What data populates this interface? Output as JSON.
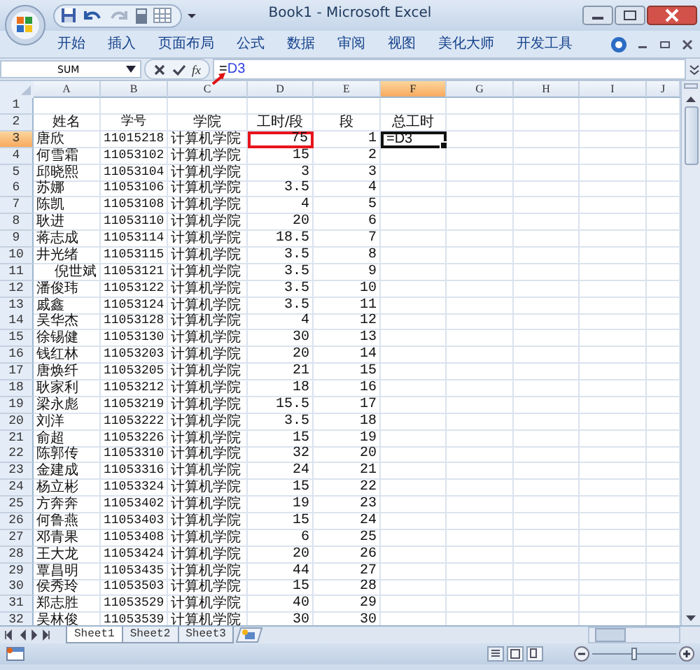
{
  "window": {
    "title": "Book1 - Microsoft Excel"
  },
  "ribbon_tabs": [
    {
      "label": "开始",
      "selected": false
    },
    {
      "label": "插入",
      "selected": false
    },
    {
      "label": "页面布局",
      "selected": false
    },
    {
      "label": "公式",
      "selected": false
    },
    {
      "label": "数据",
      "selected": false
    },
    {
      "label": "审阅",
      "selected": false
    },
    {
      "label": "视图",
      "selected": false
    },
    {
      "label": "美化大师",
      "selected": false
    },
    {
      "label": "开发工具",
      "selected": false
    }
  ],
  "formula_bar": {
    "name_box": "SUM",
    "function_button": "fx",
    "formula": [
      {
        "text": "=",
        "kind": "plain"
      },
      {
        "text": "D3",
        "kind": "reference"
      }
    ],
    "pointer_arrow": true
  },
  "sheet": {
    "columns": [
      {
        "label": "A",
        "selected": false
      },
      {
        "label": "B",
        "selected": false
      },
      {
        "label": "C",
        "selected": false
      },
      {
        "label": "D",
        "selected": false
      },
      {
        "label": "E",
        "selected": false
      },
      {
        "label": "F",
        "selected": true
      },
      {
        "label": "G",
        "selected": false
      },
      {
        "label": "H",
        "selected": false
      },
      {
        "label": "I",
        "selected": false
      },
      {
        "label": "J",
        "selected": false
      }
    ],
    "rows": [
      {
        "number": "1",
        "selected": false,
        "kind": "blank"
      },
      {
        "number": "2",
        "selected": false,
        "kind": "header",
        "cells": [
          "姓名",
          "学号",
          "学院",
          "工时/段",
          "段",
          "总工时"
        ]
      },
      {
        "number": "3",
        "selected": true,
        "kind": "data",
        "cells": [
          "唐欣",
          "11015218",
          "计算机学院",
          {
            "text": "75",
            "copied": true
          },
          "1",
          {
            "text": "=D3",
            "active": true
          }
        ]
      },
      {
        "number": "4",
        "selected": false,
        "kind": "data",
        "cells": [
          "何雪霜",
          "11053102",
          "计算机学院",
          "15",
          "2"
        ]
      },
      {
        "number": "5",
        "selected": false,
        "kind": "data",
        "cells": [
          "邱晓熙",
          "11053104",
          "计算机学院",
          "3",
          "3"
        ]
      },
      {
        "number": "6",
        "selected": false,
        "kind": "data",
        "cells": [
          "苏娜",
          "11053106",
          "计算机学院",
          "3.5",
          "4"
        ]
      },
      {
        "number": "7",
        "selected": false,
        "kind": "data",
        "cells": [
          "陈凯",
          "11053108",
          "计算机学院",
          "4",
          "5"
        ]
      },
      {
        "number": "8",
        "selected": false,
        "kind": "data",
        "cells": [
          "耿进",
          "11053110",
          "计算机学院",
          "20",
          "6"
        ]
      },
      {
        "number": "9",
        "selected": false,
        "kind": "data",
        "cells": [
          "蒋志成",
          "11053114",
          "计算机学院",
          "18.5",
          "7"
        ]
      },
      {
        "number": "10",
        "selected": false,
        "kind": "data",
        "cells": [
          "井光绪",
          "11053115",
          "计算机学院",
          "3.5",
          "8"
        ]
      },
      {
        "number": "11",
        "selected": false,
        "kind": "data_name_right",
        "cells": [
          "倪世斌",
          "11053121",
          "计算机学院",
          "3.5",
          "9"
        ]
      },
      {
        "number": "12",
        "selected": false,
        "kind": "data",
        "cells": [
          "潘俊玮",
          "11053122",
          "计算机学院",
          "3.5",
          "10"
        ]
      },
      {
        "number": "13",
        "selected": false,
        "kind": "data",
        "cells": [
          "戚鑫",
          "11053124",
          "计算机学院",
          "3.5",
          "11"
        ]
      },
      {
        "number": "14",
        "selected": false,
        "kind": "data",
        "cells": [
          "吴华杰",
          "11053128",
          "计算机学院",
          "4",
          "12"
        ]
      },
      {
        "number": "15",
        "selected": false,
        "kind": "data",
        "cells": [
          "徐锡健",
          "11053130",
          "计算机学院",
          "30",
          "13"
        ]
      },
      {
        "number": "16",
        "selected": false,
        "kind": "data",
        "cells": [
          "钱红林",
          "11053203",
          "计算机学院",
          "20",
          "14"
        ]
      },
      {
        "number": "17",
        "selected": false,
        "kind": "data",
        "cells": [
          "唐焕纤",
          "11053205",
          "计算机学院",
          "21",
          "15"
        ]
      },
      {
        "number": "18",
        "selected": false,
        "kind": "data",
        "cells": [
          "耿家利",
          "11053212",
          "计算机学院",
          "18",
          "16"
        ]
      },
      {
        "number": "19",
        "selected": false,
        "kind": "data",
        "cells": [
          "梁永彪",
          "11053219",
          "计算机学院",
          "15.5",
          "17"
        ]
      },
      {
        "number": "20",
        "selected": false,
        "kind": "data",
        "cells": [
          "刘洋",
          "11053222",
          "计算机学院",
          "3.5",
          "18"
        ]
      },
      {
        "number": "21",
        "selected": false,
        "kind": "data",
        "cells": [
          "俞超",
          "11053226",
          "计算机学院",
          "15",
          "19"
        ]
      },
      {
        "number": "22",
        "selected": false,
        "kind": "data",
        "cells": [
          "陈郭传",
          "11053310",
          "计算机学院",
          "32",
          "20"
        ]
      },
      {
        "number": "23",
        "selected": false,
        "kind": "data",
        "cells": [
          "金建成",
          "11053316",
          "计算机学院",
          "24",
          "21"
        ]
      },
      {
        "number": "24",
        "selected": false,
        "kind": "data",
        "cells": [
          "杨立彬",
          "11053324",
          "计算机学院",
          "15",
          "22"
        ]
      },
      {
        "number": "25",
        "selected": false,
        "kind": "data",
        "cells": [
          "方奔奔",
          "11053402",
          "计算机学院",
          "19",
          "23"
        ]
      },
      {
        "number": "26",
        "selected": false,
        "kind": "data",
        "cells": [
          "何鲁燕",
          "11053403",
          "计算机学院",
          "15",
          "24"
        ]
      },
      {
        "number": "27",
        "selected": false,
        "kind": "data",
        "cells": [
          "邓青果",
          "11053408",
          "计算机学院",
          "6",
          "25"
        ]
      },
      {
        "number": "28",
        "selected": false,
        "kind": "data",
        "cells": [
          "王大龙",
          "11053424",
          "计算机学院",
          "20",
          "26"
        ]
      },
      {
        "number": "29",
        "selected": false,
        "kind": "data",
        "cells": [
          "覃昌明",
          "11053435",
          "计算机学院",
          "44",
          "27"
        ]
      },
      {
        "number": "30",
        "selected": false,
        "kind": "data",
        "cells": [
          "侯秀玲",
          "11053503",
          "计算机学院",
          "15",
          "28"
        ]
      },
      {
        "number": "31",
        "selected": false,
        "kind": "data",
        "cells": [
          "郑志胜",
          "11053529",
          "计算机学院",
          "40",
          "29"
        ]
      },
      {
        "number": "32",
        "selected": false,
        "kind": "data",
        "cells": [
          "吴林俊",
          "11053539",
          "计算机学院",
          "30",
          "30"
        ]
      }
    ]
  },
  "sheet_tabs": [
    {
      "label": "Sheet1",
      "selected": true
    },
    {
      "label": "Sheet2",
      "selected": false
    },
    {
      "label": "Sheet3",
      "selected": false
    }
  ],
  "status_bar": {
    "zoom_slider": {
      "level": 0.5
    }
  }
}
